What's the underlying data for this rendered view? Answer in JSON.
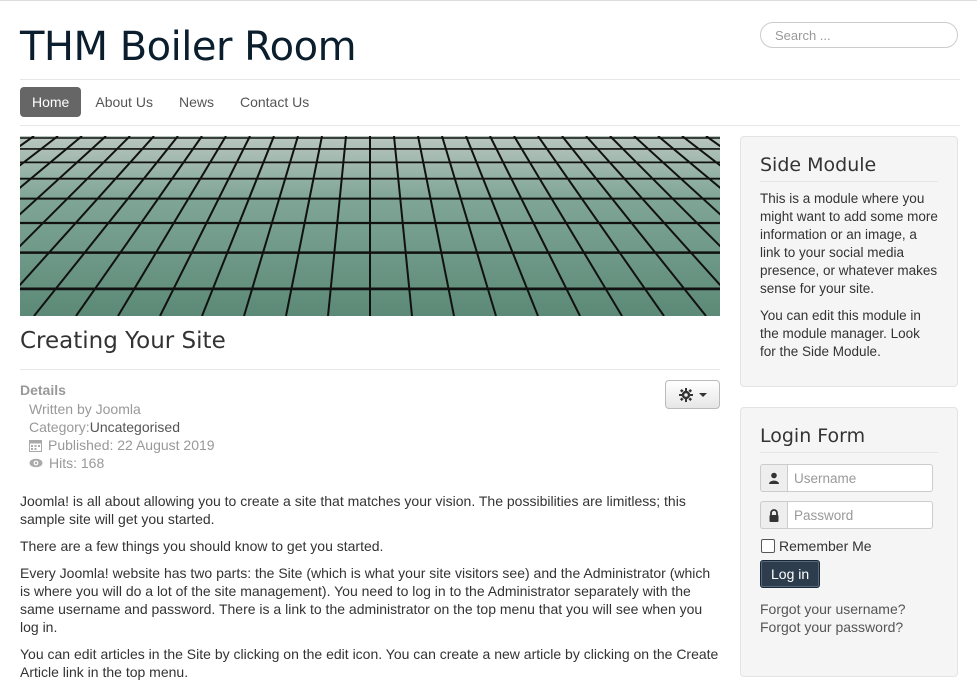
{
  "site": {
    "brand": "THM Boiler Room"
  },
  "search": {
    "placeholder": "Search ..."
  },
  "nav": {
    "items": [
      "Home",
      "About Us",
      "News",
      "Contact Us"
    ],
    "active": "Home"
  },
  "article": {
    "title": "Creating Your Site",
    "details_label": "Details",
    "written_by": "Written by Joomla",
    "category_label": "Category: ",
    "category_value": "Uncategorised",
    "published": "Published: 22 August 2019",
    "hits": "Hits: 168",
    "paragraphs": [
      "Joomla! is all about allowing you to create a site that matches your vision. The possibilities are limitless; this sample site will get you started.",
      "There are a few things you should know to get you started.",
      "Every Joomla! website has two parts: the Site (which is what your site visitors see) and the Administrator (which is where you will do a lot of the site management). You need to log in to the Administrator separately with the same username and password. There is a link to the administrator on the top menu that you will see when you log in.",
      "You can edit articles in the Site by clicking on the edit icon. You can create a new article by clicking on the Create Article link in the top menu."
    ]
  },
  "side_module": {
    "title": "Side Module",
    "paragraphs": [
      "This is a module where you might want to add some more information or an image, a link to your social media presence, or whatever makes sense for your site.",
      "You can edit this module in the module manager. Look for the Side Module."
    ]
  },
  "login": {
    "title": "Login Form",
    "username_placeholder": "Username",
    "password_placeholder": "Password",
    "remember_label": "Remember Me",
    "button_label": "Log in",
    "forgot_username": "Forgot your username?",
    "forgot_password": "Forgot your password?"
  },
  "icons": {
    "gear": "gear-icon",
    "calendar": "calendar-icon",
    "eye": "eye-icon",
    "user": "user-icon",
    "lock": "lock-icon"
  },
  "colors": {
    "nav_active_bg": "#666666",
    "brand_text": "#0b1e2d",
    "login_button": "#2d3d4d"
  }
}
